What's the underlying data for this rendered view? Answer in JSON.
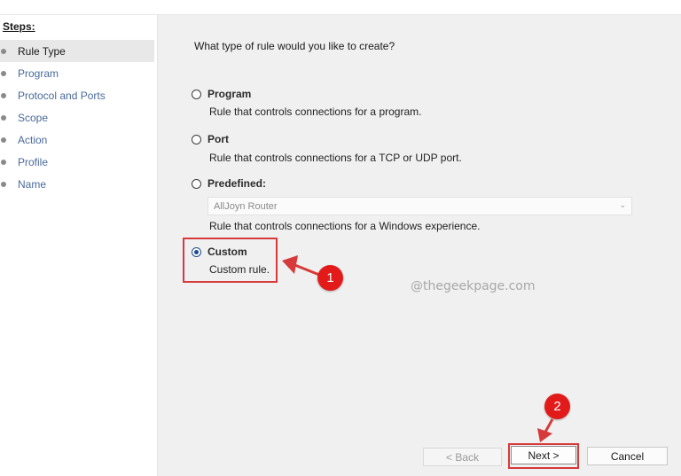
{
  "sidebar": {
    "title": "Steps:",
    "steps": [
      {
        "label": "Rule Type"
      },
      {
        "label": "Program"
      },
      {
        "label": "Protocol and Ports"
      },
      {
        "label": "Scope"
      },
      {
        "label": "Action"
      },
      {
        "label": "Profile"
      },
      {
        "label": "Name"
      }
    ]
  },
  "main": {
    "question": "What type of rule would you like to create?",
    "options": [
      {
        "title": "Program",
        "description": "Rule that controls connections for a program.",
        "selected": false
      },
      {
        "title": "Port",
        "description": "Rule that controls connections for a TCP or UDP port.",
        "selected": false
      },
      {
        "title": "Predefined:",
        "description": "Rule that controls connections for a Windows experience.",
        "selected": false
      },
      {
        "title": "Custom",
        "description": "Custom rule.",
        "selected": true
      }
    ],
    "predefined_dropdown": {
      "value": "AllJoyn Router"
    },
    "watermark": "@thegeekpage.com"
  },
  "buttons": {
    "back": "< Back",
    "next": "Next >",
    "cancel": "Cancel"
  },
  "annotations": {
    "badge1": "1",
    "badge2": "2"
  },
  "colors": {
    "annotation": "#d63a3a",
    "badge": "#e21a1a",
    "main_bg": "#f0f0f0"
  }
}
